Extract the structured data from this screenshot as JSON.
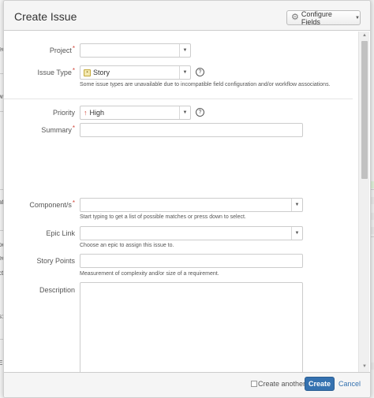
{
  "dialog": {
    "title": "Create Issue",
    "configure_fields_label": "Configure Fields"
  },
  "fields": {
    "project": {
      "label": "Project",
      "value": ""
    },
    "issue_type": {
      "label": "Issue Type",
      "value": "Story",
      "description": "Some issue types are unavailable due to incompatible field configuration and/or workflow associations."
    },
    "priority": {
      "label": "Priority",
      "value": "High"
    },
    "summary": {
      "label": "Summary",
      "value": ""
    },
    "components": {
      "label": "Component/s",
      "value": "",
      "description": "Start typing to get a list of possible matches or press down to select."
    },
    "epic_link": {
      "label": "Epic Link",
      "value": "",
      "description": "Choose an epic to assign this issue to."
    },
    "story_points": {
      "label": "Story Points",
      "value": "",
      "description": "Measurement of complexity and/or size of a requirement."
    },
    "description": {
      "label": "Description",
      "value": ""
    }
  },
  "footer": {
    "create_another_label": "Create another",
    "create_label": "Create",
    "cancel_label": "Cancel"
  },
  "icons": {
    "configure": "gear-icon",
    "issue_type": "story-icon",
    "priority": "arrow-up-icon",
    "help": "help-icon",
    "dropdown": "chevron-down-icon"
  },
  "colors": {
    "primary_button": "#3572b0",
    "required_marker": "#d04437",
    "priority_high": "#d04437"
  }
}
